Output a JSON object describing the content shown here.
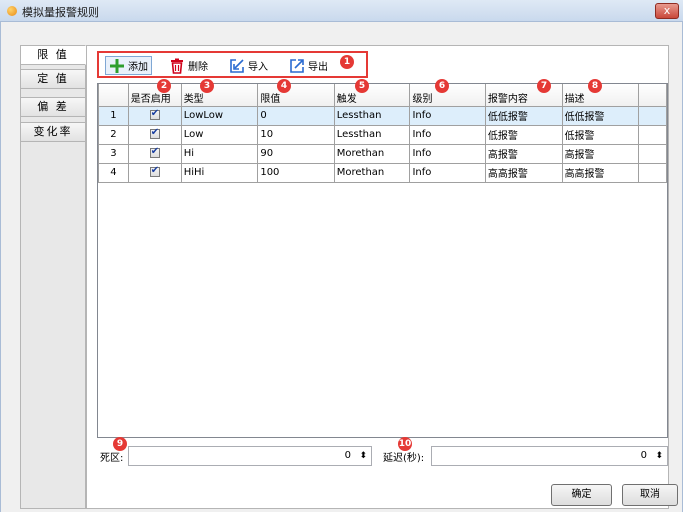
{
  "window": {
    "title": "模拟量报警规则",
    "close_label": "x"
  },
  "tabs": [
    "限 值",
    "定 值",
    "偏 差",
    "变化率"
  ],
  "toolbar": {
    "add_label": "添加",
    "delete_label": "删除",
    "import_label": "导入",
    "export_label": "导出"
  },
  "badges": [
    "1",
    "2",
    "3",
    "4",
    "5",
    "6",
    "7",
    "8",
    "9",
    "10"
  ],
  "table": {
    "columns": [
      "是否启用",
      "类型",
      "限值",
      "触发",
      "级别",
      "报警内容",
      "描述"
    ],
    "rows": [
      {
        "num": "1",
        "enabled": true,
        "type": "LowLow",
        "limit": "0",
        "trigger": "Lessthan",
        "level": "Info",
        "content": "低低报警",
        "desc": "低低报警"
      },
      {
        "num": "2",
        "enabled": true,
        "type": "Low",
        "limit": "10",
        "trigger": "Lessthan",
        "level": "Info",
        "content": "低报警",
        "desc": "低报警"
      },
      {
        "num": "3",
        "enabled": true,
        "type": "Hi",
        "limit": "90",
        "trigger": "Morethan",
        "level": "Info",
        "content": "高报警",
        "desc": "高报警"
      },
      {
        "num": "4",
        "enabled": true,
        "type": "HiHi",
        "limit": "100",
        "trigger": "Morethan",
        "level": "Info",
        "content": "高高报警",
        "desc": "高高报警"
      }
    ]
  },
  "deadband": {
    "label": "死区:",
    "value": "0"
  },
  "delay": {
    "label": "延迟(秒):",
    "value": "0"
  },
  "buttons": {
    "ok_label": "确定",
    "cancel_label": "取消"
  },
  "colors": {
    "highlight": "#e53935",
    "add_icon": "#2e9e2e",
    "delete_icon": "#d0021b",
    "io_icon": "#2a6bd1"
  }
}
